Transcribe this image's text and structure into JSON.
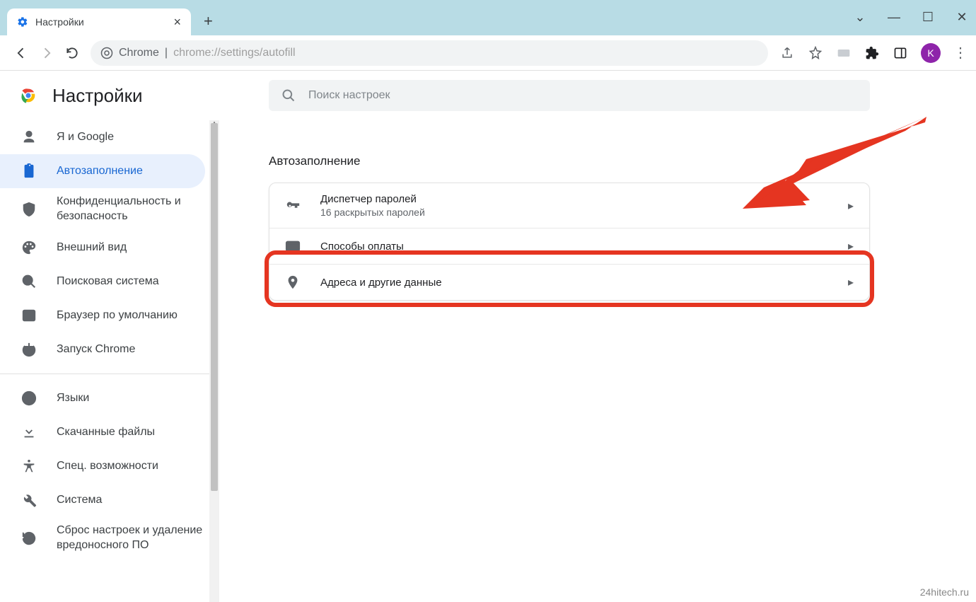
{
  "window": {
    "tab_title": "Настройки",
    "avatar_letter": "K"
  },
  "omnibox": {
    "prefix": "Chrome",
    "url": "chrome://settings/autofill"
  },
  "header": {
    "title": "Настройки"
  },
  "search": {
    "placeholder": "Поиск настроек"
  },
  "sidebar": {
    "items": [
      {
        "label": "Я и Google"
      },
      {
        "label": "Автозаполнение"
      },
      {
        "label": "Конфиденциальность и безопасность"
      },
      {
        "label": "Внешний вид"
      },
      {
        "label": "Поисковая система"
      },
      {
        "label": "Браузер по умолчанию"
      },
      {
        "label": "Запуск Chrome"
      }
    ],
    "items2": [
      {
        "label": "Языки"
      },
      {
        "label": "Скачанные файлы"
      },
      {
        "label": "Спец. возможности"
      },
      {
        "label": "Система"
      },
      {
        "label": "Сброс настроек и удаление вредоносного ПО"
      }
    ]
  },
  "section": {
    "title": "Автозаполнение",
    "rows": [
      {
        "title": "Диспетчер паролей",
        "sub": "16 раскрытых паролей"
      },
      {
        "title": "Способы оплаты",
        "sub": ""
      },
      {
        "title": "Адреса и другие данные",
        "sub": ""
      }
    ]
  },
  "watermark": "24hitech.ru"
}
